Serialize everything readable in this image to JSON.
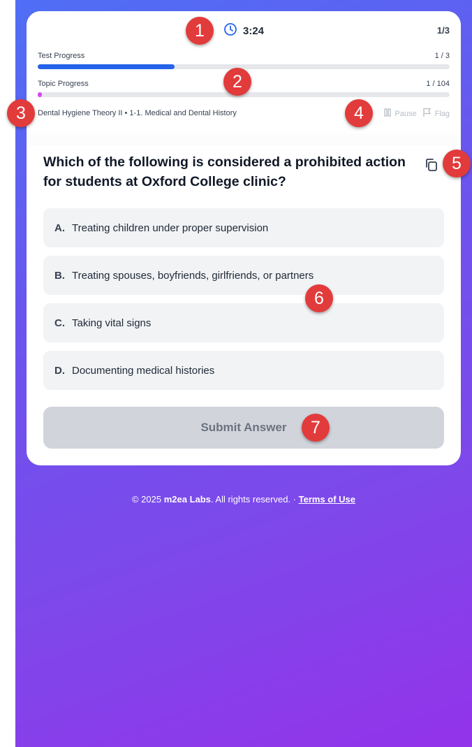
{
  "timer": {
    "value": "3:24"
  },
  "question_counter": "1/3",
  "test_progress": {
    "label": "Test Progress",
    "value": "1 / 3",
    "fraction": 0.333,
    "color": "#2563eb"
  },
  "topic_progress": {
    "label": "Topic Progress",
    "value": "1 / 104",
    "fraction": 0.0096,
    "color": "#d946ef"
  },
  "breadcrumb": "Dental Hygiene Theory II • 1-1. Medical and Dental History",
  "controls": {
    "pause_label": "Pause",
    "flag_label": "Flag"
  },
  "question": {
    "text": "Which of the following is considered a prohibited action for students at Oxford College clinic?",
    "options": [
      {
        "letter": "A.",
        "text": "Treating children under proper supervision"
      },
      {
        "letter": "B.",
        "text": "Treating spouses, boyfriends, girlfriends, or partners"
      },
      {
        "letter": "C.",
        "text": "Taking vital signs"
      },
      {
        "letter": "D.",
        "text": "Documenting medical histories"
      }
    ]
  },
  "submit_label": "Submit Answer",
  "footer": {
    "prefix": "© 2025 ",
    "brand": "m2ea Labs",
    "middle": ". All rights reserved. · ",
    "terms": "Terms of Use"
  },
  "markers": [
    "1",
    "2",
    "3",
    "4",
    "5",
    "6",
    "7"
  ],
  "colors": {
    "accent": "#2563eb",
    "marker": "#e23b3b"
  }
}
